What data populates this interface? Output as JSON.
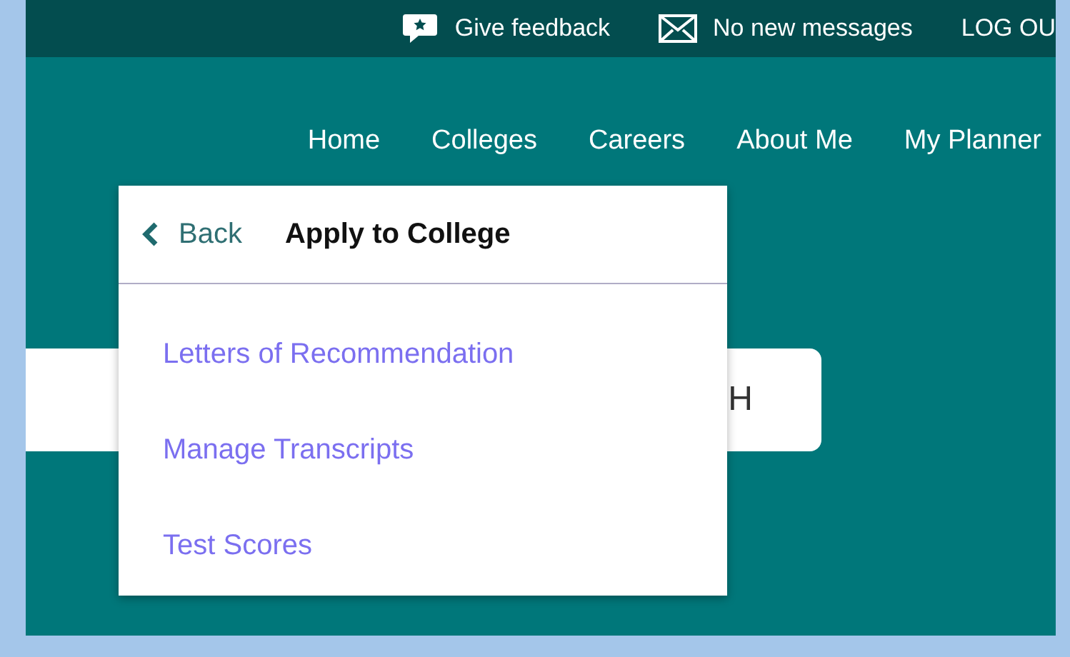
{
  "top_bar": {
    "feedback": "Give feedback",
    "messages": "No new messages",
    "logout": "LOG OU"
  },
  "nav": [
    "Home",
    "Colleges",
    "Careers",
    "About Me",
    "My Planner"
  ],
  "search": {
    "label": "H"
  },
  "dropdown": {
    "back": "Back",
    "title": "Apply to College",
    "items": [
      {
        "label": "Letters of Recommendation"
      },
      {
        "label": "Manage Transcripts"
      },
      {
        "label": "Test Scores"
      }
    ]
  }
}
